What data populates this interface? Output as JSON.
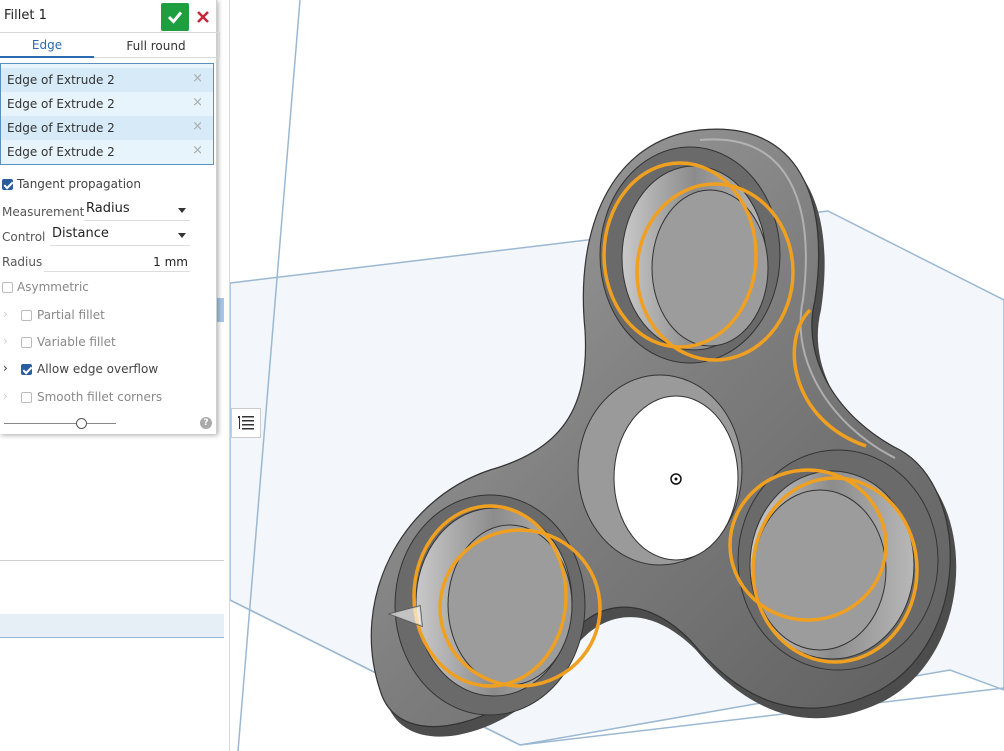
{
  "dialog": {
    "title": "Fillet 1",
    "tabs": [
      {
        "label": "Edge",
        "active": true
      },
      {
        "label": "Full round",
        "active": false
      }
    ],
    "selections": [
      {
        "label": "Edge of Extrude 2"
      },
      {
        "label": "Edge of Extrude 2"
      },
      {
        "label": "Edge of Extrude 2"
      },
      {
        "label": "Edge of Extrude 2"
      }
    ],
    "remove_glyph": "×",
    "tangent_propagation": {
      "label": "Tangent propagation",
      "checked": true
    },
    "measurement": {
      "label": "Measurement",
      "value": "Radius"
    },
    "control": {
      "label": "Control",
      "value": "Distance"
    },
    "radius": {
      "label": "Radius",
      "value": "1 mm"
    },
    "asymmetric": {
      "label": "Asymmetric",
      "checked": false
    },
    "partial_fillet": {
      "label": "Partial fillet",
      "checked": false
    },
    "variable_fillet": {
      "label": "Variable fillet",
      "checked": false
    },
    "allow_edge_overflow": {
      "label": "Allow edge overflow",
      "checked": true
    },
    "smooth_fillet_corners": {
      "label": "Smooth fillet corners",
      "checked": false
    },
    "help_glyph": "?",
    "chevron_glyph": "›"
  },
  "colors": {
    "accent": "#2a6aae",
    "confirm": "#1e9e3e",
    "cancel": "#c8283c",
    "selected_edge": "#f0a020",
    "model_body": "#8a8a8a",
    "plane": "#9bb8d3"
  },
  "icons": {
    "confirm": "check-icon",
    "cancel": "close-icon",
    "feature_list": "feature-list-icon",
    "origin": "origin-icon",
    "triad": "triad-icon"
  }
}
